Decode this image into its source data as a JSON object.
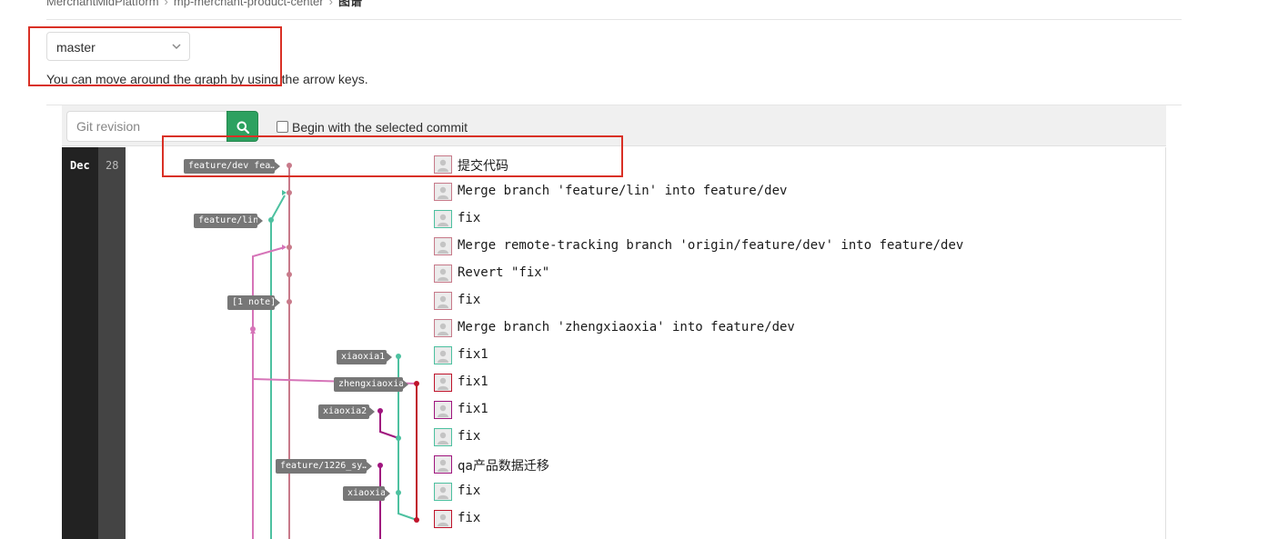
{
  "breadcrumb": {
    "items": [
      "MerchantMidPlatform",
      "mp-merchant-product-center",
      "图谱"
    ]
  },
  "branch_select": {
    "value": "master"
  },
  "hint": "You can move around the graph by using the arrow keys.",
  "toolbar": {
    "revision_placeholder": "Git revision",
    "search_icon": "search-icon",
    "begin_label": "Begin with the selected commit",
    "begin_checked": false
  },
  "graph": {
    "month": "Dec",
    "day": "28",
    "colors": {
      "pink": "#c87a8a",
      "teal": "#4dc1a0",
      "crimson": "#c0142b",
      "magenta": "#a0157e",
      "lilac": "#d674b8"
    },
    "refs": [
      {
        "label": "feature/dev fea…"
      },
      {
        "label": "feature/lin"
      },
      {
        "label": "[1 note]"
      },
      {
        "label": "xiaoxia1"
      },
      {
        "label": "zhengxiaoxia"
      },
      {
        "label": "xiaoxia2"
      },
      {
        "label": "feature/1226_sy…"
      },
      {
        "label": "xiaoxia"
      }
    ],
    "commits": [
      {
        "message": "提交代码",
        "avatar_color": "#c87a8a"
      },
      {
        "message": "Merge branch 'feature/lin' into feature/dev",
        "avatar_color": "#c87a8a"
      },
      {
        "message": "fix",
        "avatar_color": "#4dc1a0"
      },
      {
        "message": "Merge remote-tracking branch 'origin/feature/dev' into feature/dev",
        "avatar_color": "#c87a8a"
      },
      {
        "message": "Revert \"fix\"",
        "avatar_color": "#c87a8a"
      },
      {
        "message": "fix",
        "avatar_color": "#c87a8a"
      },
      {
        "message": "Merge branch 'zhengxiaoxia' into feature/dev",
        "avatar_color": "#c87a8a"
      },
      {
        "message": "fix1",
        "avatar_color": "#4dc1a0"
      },
      {
        "message": "fix1",
        "avatar_color": "#c0142b"
      },
      {
        "message": "fix1",
        "avatar_color": "#a0157e"
      },
      {
        "message": "fix",
        "avatar_color": "#4dc1a0"
      },
      {
        "message": "qa产品数据迁移",
        "avatar_color": "#a0157e"
      },
      {
        "message": "fix",
        "avatar_color": "#4dc1a0"
      },
      {
        "message": "fix",
        "avatar_color": "#c0142b"
      }
    ]
  }
}
